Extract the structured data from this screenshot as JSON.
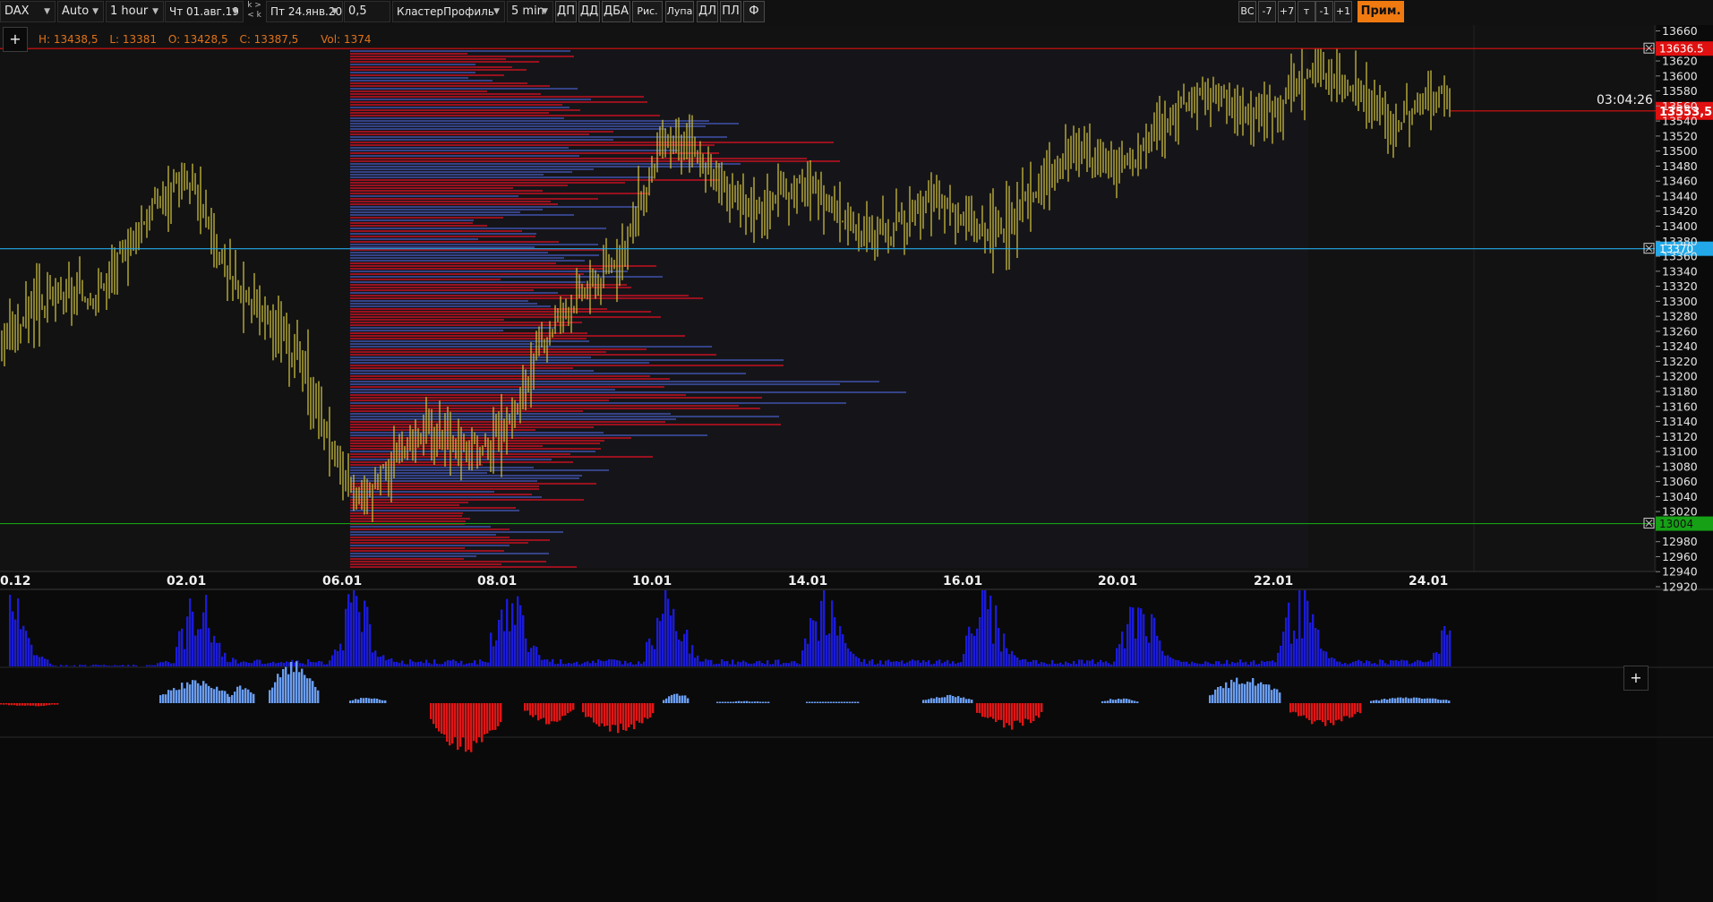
{
  "toolbar": {
    "symbol": "DAX",
    "scale": "Auto",
    "timeframe": "1 hour",
    "date_from": "Чт 01.авг.19",
    "nav_top": "k >",
    "nav_bottom": "< k",
    "date_to": "Пт 24.янв.20",
    "step": "0,5",
    "chart_type": "КластерПрофиль",
    "aggregation": "5 min",
    "buttons": [
      "ДП",
      "ДД",
      "ДБА",
      "Рис.",
      "Лупа",
      "ДЛ",
      "ПЛ",
      "Ф"
    ],
    "right_buttons": [
      "ВС",
      "-7",
      "+7",
      "т",
      "-1",
      "+1"
    ],
    "prim_label": "Прим."
  },
  "ohlc": {
    "high": "H: 13438,5",
    "low": "L: 13381",
    "open": "O: 13428,5",
    "close": "C: 13387,5",
    "volume": "Vol: 1374"
  },
  "price_axis": {
    "ticks": [
      "13660",
      "13620",
      "13600",
      "13580",
      "13560",
      "13540",
      "13520",
      "13500",
      "13480",
      "13460",
      "13440",
      "13420",
      "13400",
      "13380",
      "13360",
      "13340",
      "13320",
      "13300",
      "13280",
      "13260",
      "13240",
      "13220",
      "13200",
      "13180",
      "13160",
      "13140",
      "13120",
      "13100",
      "13080",
      "13060",
      "13040",
      "13020",
      "12980",
      "12960",
      "12940",
      "12920"
    ]
  },
  "levels": {
    "red": {
      "price": 13636.5,
      "label": "13636.5",
      "color": "#e01010"
    },
    "blue": {
      "price": 13370,
      "label": "13370",
      "color": "#22a8e8"
    },
    "green": {
      "price": 13004,
      "label": "13004",
      "color": "#16a016"
    }
  },
  "current_price": {
    "label": "13553,5",
    "price": 13553.5,
    "timer": "03:04:26",
    "color": "#e01010"
  },
  "date_axis": [
    "0.12",
    "02.01",
    "06.01",
    "08.01",
    "10.01",
    "14.01",
    "16.01",
    "20.01",
    "22.01",
    "24.01"
  ],
  "colors": {
    "bars": "#c9bb3e",
    "volume": "#1b1bd8",
    "delta_pos": "#6a9df0",
    "delta_neg": "#e01515",
    "profile_red": "#b01020",
    "profile_blue": "#3a4a9a"
  },
  "chart_data": {
    "type": "bar",
    "title": "DAX",
    "timeframe": "1 hour",
    "ylim": [
      12920,
      13660
    ],
    "x": [
      "0.12",
      "02.01",
      "06.01",
      "08.01",
      "10.01",
      "14.01",
      "16.01",
      "20.01",
      "22.01",
      "24.01"
    ],
    "series": [
      {
        "name": "DAX",
        "close": [
          13230,
          13450,
          13060,
          13140,
          13490,
          13420,
          13400,
          13520,
          13590,
          13553.5
        ],
        "high": [
          13310,
          13450,
          13120,
          13270,
          13550,
          13500,
          13420,
          13560,
          13636.5,
          13570
        ],
        "low": [
          13150,
          13100,
          12950,
          12960,
          13380,
          13360,
          13380,
          13440,
          13380,
          13480
        ]
      }
    ],
    "levels": [
      13636.5,
      13370,
      13004
    ],
    "last_bar": {
      "high": 13438.5,
      "low": 13381,
      "open": 13428.5,
      "close": 13387.5,
      "volume": 1374
    }
  }
}
